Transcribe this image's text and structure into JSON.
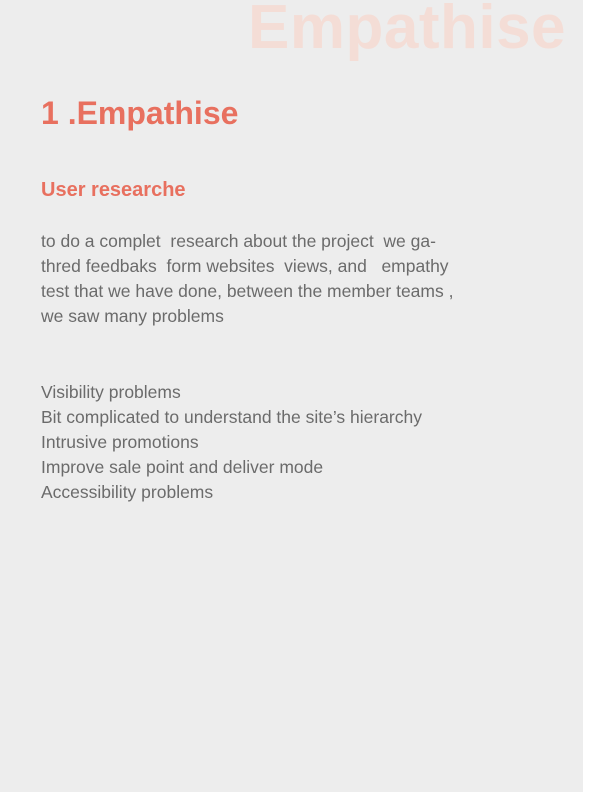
{
  "watermark": "Empathise",
  "heading": "1 .Empathise",
  "subheading": "User researche",
  "intro_lines": [
    "to do a complet  research about the project  we ga-",
    "thred feedbaks  form websites  views, and   empathy",
    "test that we have done, between the member teams ,",
    "we saw many problems"
  ],
  "problems": [
    "Visibility problems",
    "Bit complicated to understand the site’s hierarchy",
    "Intrusive promotions",
    "Improve sale point and deliver mode",
    "Accessibility problems"
  ],
  "colors": {
    "accent": "#e8705f",
    "watermark": "#f4ddd6",
    "panel_background": "#ededed",
    "body_text": "#6b6b6b"
  }
}
